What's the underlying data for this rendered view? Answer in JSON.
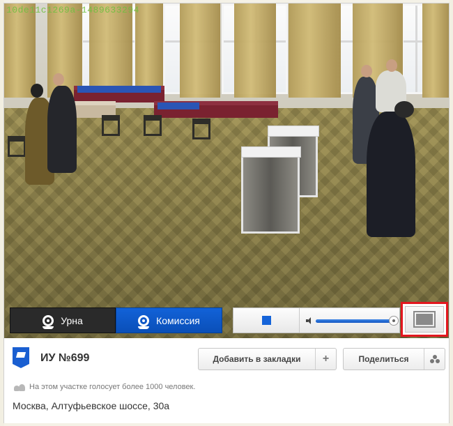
{
  "camera": {
    "overlay_id": "10de11c1269a-1489633294"
  },
  "tabs": [
    {
      "label": "Урна",
      "active": false
    },
    {
      "label": "Комиссия",
      "active": true
    }
  ],
  "player": {
    "stop_label": "stop",
    "volume_percent": 100
  },
  "station": {
    "title": "ИУ №699",
    "bookmark_label": "Добавить в закладки",
    "bookmark_add_symbol": "+",
    "share_label": "Поделиться",
    "note": "На этом участке голосует более 1000 человек.",
    "address": "Москва, Алтуфьевское шоссе, 30а"
  },
  "colors": {
    "accent": "#1262d8",
    "highlight": "#e3171f",
    "dark_tab": "#2a2a2a"
  },
  "icons": [
    "urn-icon",
    "commission-icon",
    "stop-icon",
    "volume-icon",
    "fullscreen-icon",
    "station-badge-icon",
    "share-icon",
    "people-icon"
  ]
}
